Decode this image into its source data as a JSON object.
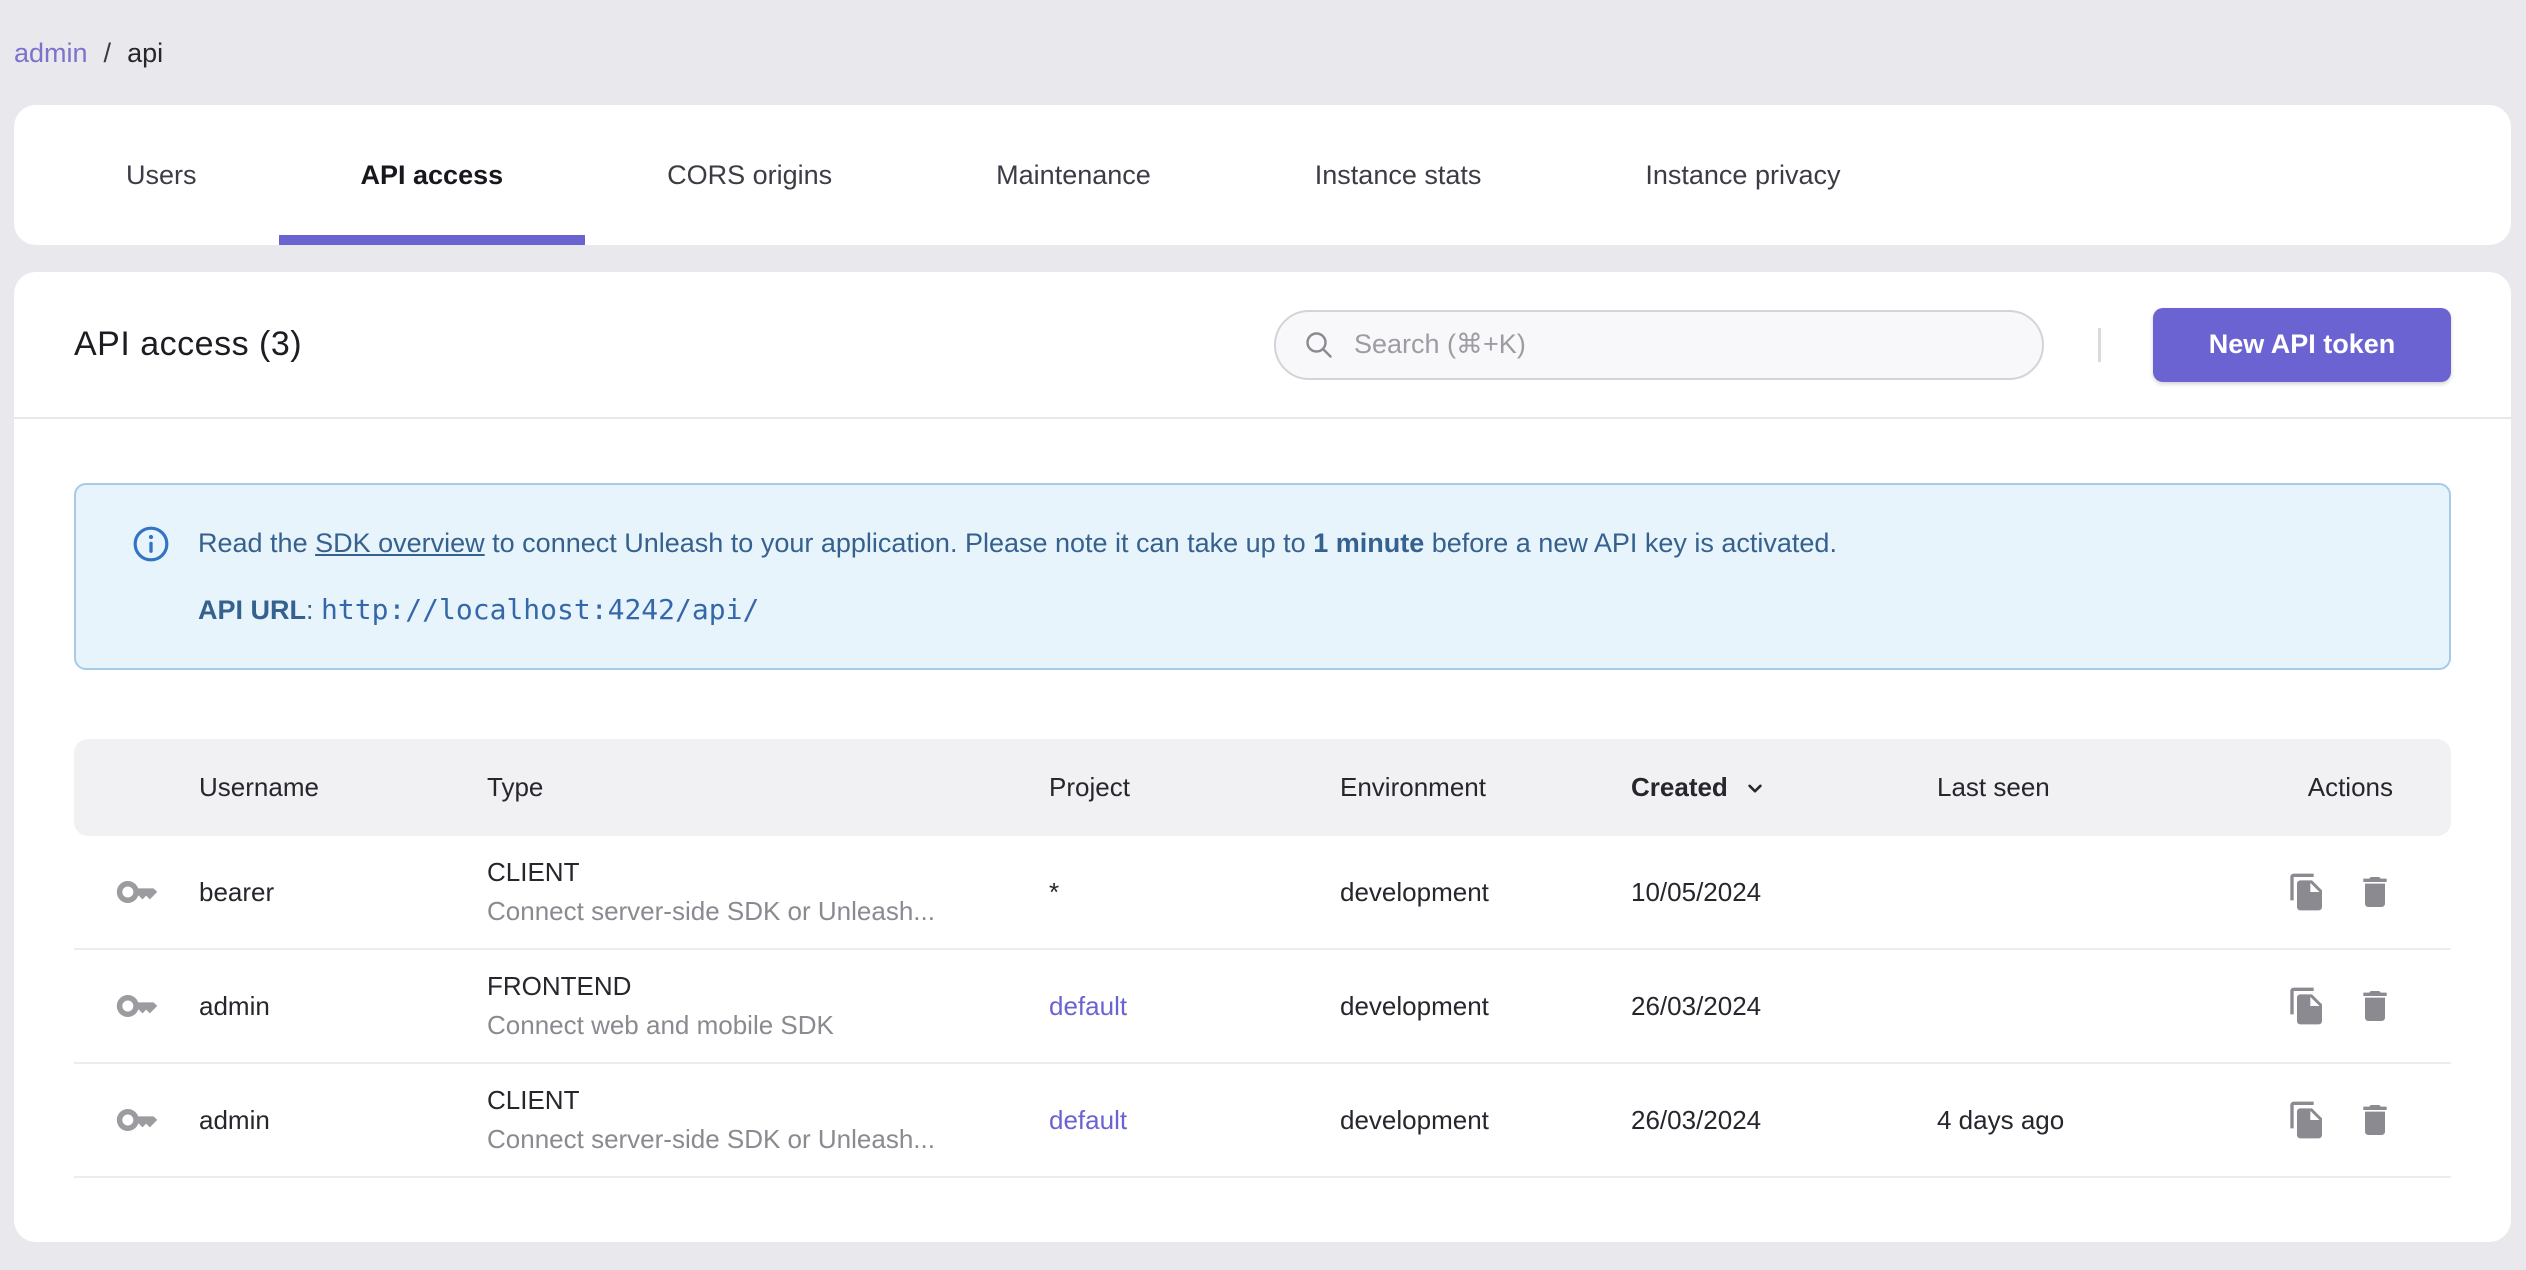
{
  "breadcrumb": {
    "items": [
      "admin",
      "api"
    ],
    "separator": "/"
  },
  "tabs": [
    {
      "label": "Users",
      "active": false
    },
    {
      "label": "API access",
      "active": true
    },
    {
      "label": "CORS origins",
      "active": false
    },
    {
      "label": "Maintenance",
      "active": false
    },
    {
      "label": "Instance stats",
      "active": false
    },
    {
      "label": "Instance privacy",
      "active": false
    }
  ],
  "header": {
    "title": "API access (3)",
    "search_placeholder": "Search (⌘+K)",
    "new_token_button": "New API token"
  },
  "alert": {
    "text_prefix": "Read the ",
    "link_text": "SDK overview",
    "text_middle": " to connect Unleash to your application. Please note it can take up to ",
    "text_bold": "1 minute",
    "text_suffix": " before a new API key is activated.",
    "api_url_label": "API URL",
    "api_url_separator": ": ",
    "api_url": "http://localhost:4242/api/"
  },
  "table": {
    "columns": [
      "Username",
      "Type",
      "Project",
      "Environment",
      "Created",
      "Last seen",
      "Actions"
    ],
    "sorted_column": "Created",
    "sort_direction": "desc",
    "rows": [
      {
        "username": "bearer",
        "type": "CLIENT",
        "type_desc": "Connect server-side SDK or Unleash...",
        "project": "*",
        "environment": "development",
        "created": "10/05/2024",
        "last_seen": ""
      },
      {
        "username": "admin",
        "type": "FRONTEND",
        "type_desc": "Connect web and mobile SDK",
        "project": "default",
        "environment": "development",
        "created": "26/03/2024",
        "last_seen": ""
      },
      {
        "username": "admin",
        "type": "CLIENT",
        "type_desc": "Connect server-side SDK or Unleash...",
        "project": "default",
        "environment": "development",
        "created": "26/03/2024",
        "last_seen": "4 days ago"
      }
    ]
  },
  "colors": {
    "primary": "#6C63D2",
    "breadcrumb_link": "#7B72CC",
    "page_background": "#E9E9ED",
    "alert_background": "#E8F4FC",
    "alert_border": "#A5CBE8",
    "alert_text": "#35618F",
    "table_header_background": "#F1F1F4",
    "secondary_text": "#8A8A91",
    "icon_gray": "#8F8F96"
  }
}
